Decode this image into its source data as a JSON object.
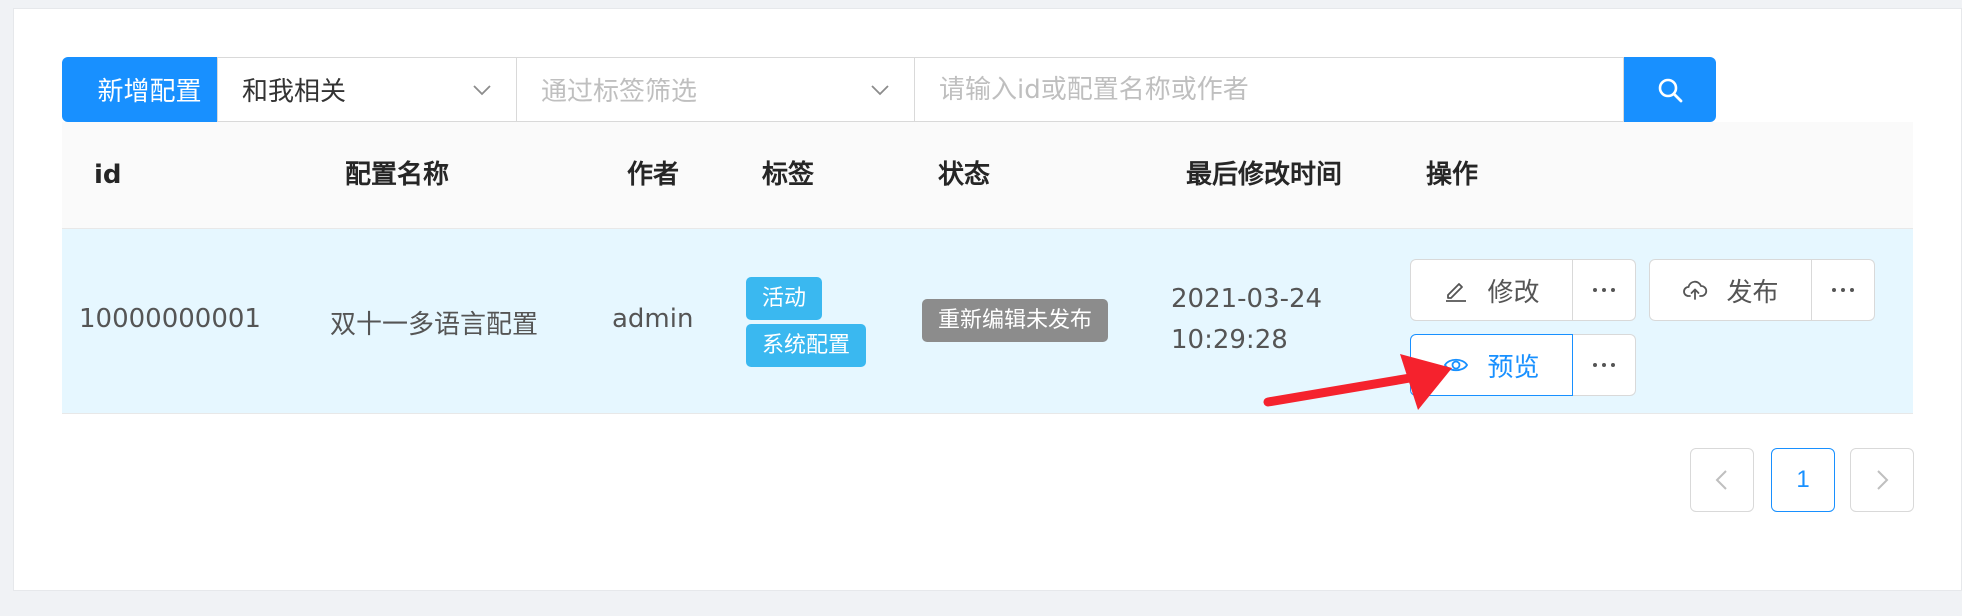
{
  "toolbar": {
    "new_button_label": "新增配置",
    "filter_select_value": "和我相关",
    "tag_filter_placeholder": "通过标签筛选",
    "search_placeholder": "请输入id或配置名称或作者"
  },
  "table": {
    "columns": [
      "id",
      "配置名称",
      "作者",
      "标签",
      "状态",
      "最后修改时间",
      "操作"
    ],
    "rows": [
      {
        "id": "10000000001",
        "name": "双十一多语言配置",
        "author": "admin",
        "tags": [
          "活动",
          "系统配置"
        ],
        "status": "重新编辑未发布",
        "modified_date": "2021-03-24",
        "modified_time": "10:29:28"
      }
    ],
    "actions": {
      "edit_label": "修改",
      "publish_label": "发布",
      "preview_label": "预览"
    }
  },
  "pagination": {
    "current_page": "1",
    "prev_symbol": "<",
    "next_symbol": ">"
  },
  "colors": {
    "primary": "#1890ff",
    "tag": "#3ab8f0",
    "status_gray": "#8c8c8c",
    "row_highlight": "#e6f7ff",
    "annotation_arrow": "#f5222d"
  },
  "icons": [
    "chevron-down-icon",
    "search-icon",
    "edit-icon",
    "upload-cloud-icon",
    "eye-icon",
    "more-icon",
    "chevron-left-icon",
    "chevron-right-icon"
  ]
}
